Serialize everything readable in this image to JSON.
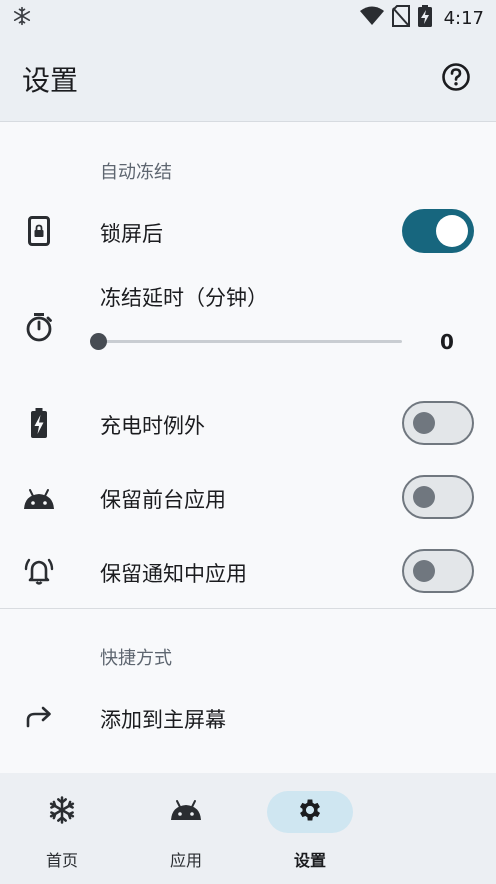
{
  "status_bar": {
    "time": "4:17"
  },
  "app_bar": {
    "title": "设置"
  },
  "sections": {
    "auto_freeze": {
      "header": "自动冻结"
    },
    "shortcuts": {
      "header": "快捷方式"
    }
  },
  "settings": {
    "lock_screen": {
      "label": "锁屏后",
      "enabled": true
    },
    "freeze_delay": {
      "label": "冻结延时（分钟）",
      "value": "0",
      "min": 0,
      "max": 60
    },
    "charging": {
      "label": "充电时例外",
      "enabled": false
    },
    "foreground": {
      "label": "保留前台应用",
      "enabled": false
    },
    "notification": {
      "label": "保留通知中应用",
      "enabled": false
    },
    "add_home": {
      "label": "添加到主屏幕"
    }
  },
  "bottom_nav": {
    "items": [
      {
        "label": "首页",
        "icon": "snowflake-icon",
        "active": false
      },
      {
        "label": "应用",
        "icon": "android-icon",
        "active": false
      },
      {
        "label": "设置",
        "icon": "gear-icon",
        "active": true
      }
    ]
  },
  "colors": {
    "accent": "#17667e",
    "app_bar_bg": "#ebeff3",
    "nav_active_bg": "#cfe6f1"
  }
}
